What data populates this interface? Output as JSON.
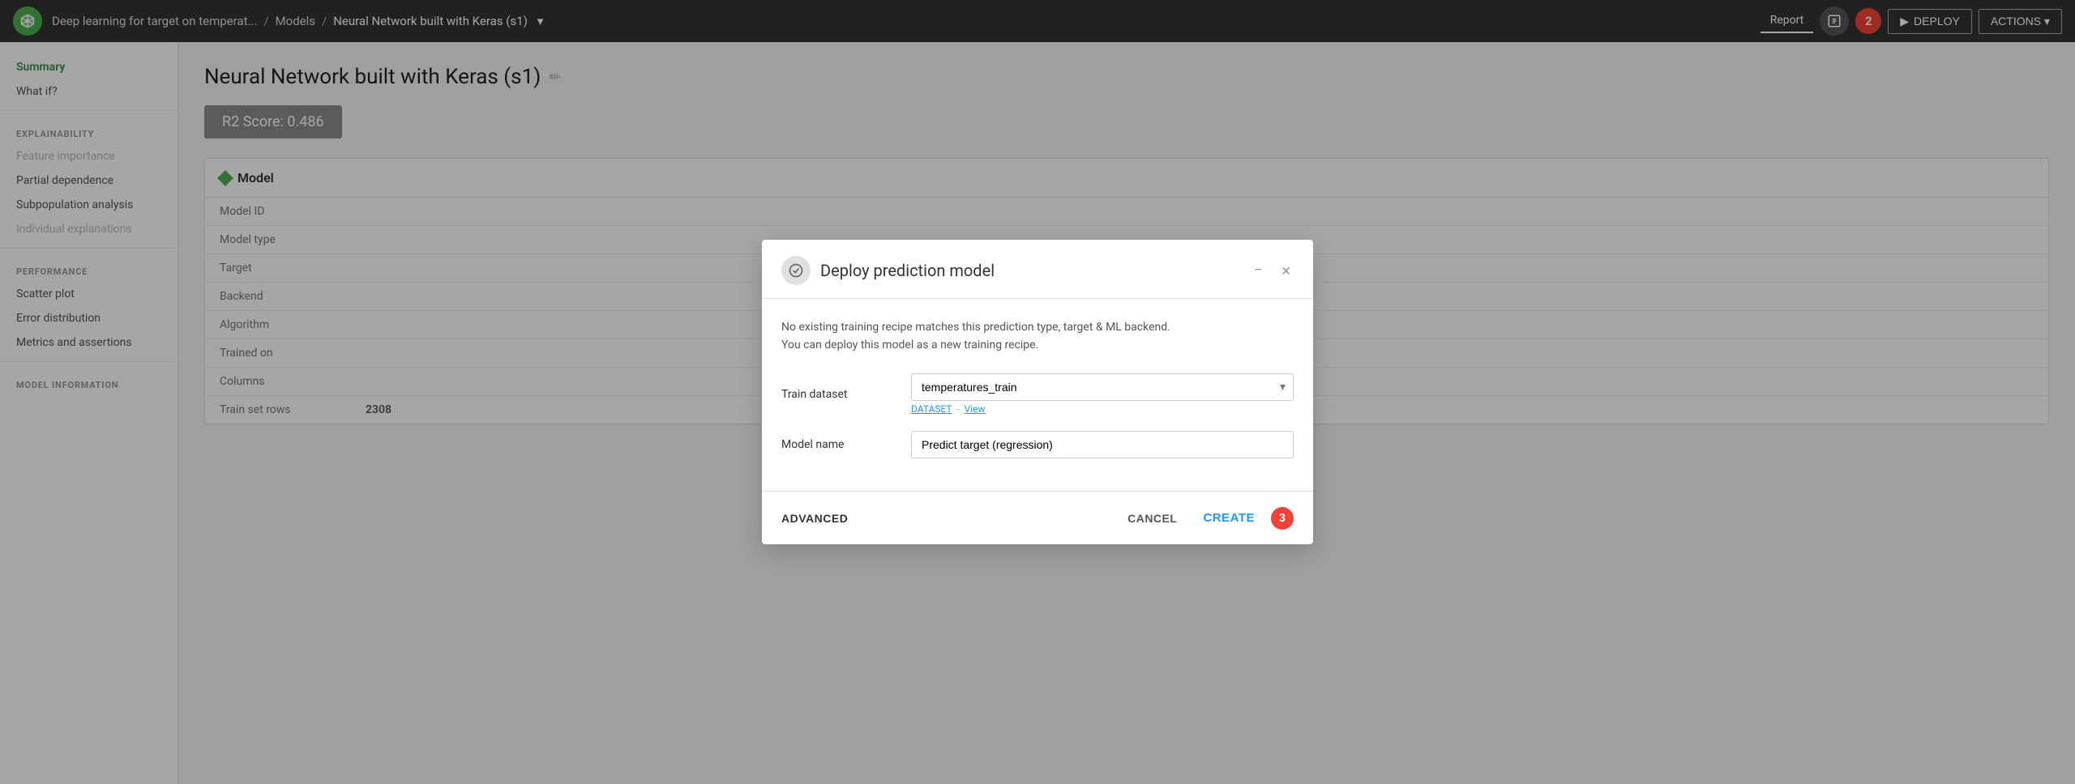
{
  "app": {
    "logo_alt": "Dataiku logo"
  },
  "topnav": {
    "breadcrumb": [
      {
        "label": "Deep learning for target on temperat...",
        "active": false
      },
      {
        "label": "Models",
        "active": false
      },
      {
        "label": "Neural Network built with Keras (s1)",
        "active": true
      }
    ],
    "report_label": "Report",
    "deploy_label": "DEPLOY",
    "actions_label": "ACTIONS",
    "step2_badge": "2"
  },
  "sidebar": {
    "summary_label": "Summary",
    "whatif_label": "What if?",
    "explainability_title": "EXPLAINABILITY",
    "feature_importance_label": "Feature importance",
    "partial_dependence_label": "Partial dependence",
    "subpopulation_analysis_label": "Subpopulation analysis",
    "individual_explanations_label": "Individual explanations",
    "performance_title": "PERFORMANCE",
    "scatter_plot_label": "Scatter plot",
    "error_distribution_label": "Error distribution",
    "metrics_assertions_label": "Metrics and assertions",
    "model_information_title": "MODEL INFORMATION"
  },
  "main": {
    "page_title": "Neural Network built with Keras (s1)",
    "edit_icon": "✏",
    "r2_score_label": "R2 Score: 0.486",
    "model_section_title": "Model",
    "table_rows": [
      {
        "label": "Model ID",
        "value": ""
      },
      {
        "label": "Model type",
        "value": ""
      },
      {
        "label": "Target",
        "value": ""
      },
      {
        "label": "Backend",
        "value": ""
      },
      {
        "label": "Algorithm",
        "value": ""
      },
      {
        "label": "Trained on",
        "value": ""
      },
      {
        "label": "Columns",
        "value": ""
      },
      {
        "label": "Train set rows",
        "value": "2308"
      }
    ]
  },
  "modal": {
    "title": "Deploy prediction model",
    "description_line1": "No existing training recipe matches this prediction type, target & ML backend.",
    "description_line2": "You can deploy this model as a new training recipe.",
    "train_dataset_label": "Train dataset",
    "train_dataset_value": "temperatures_train",
    "train_dataset_sub": "DATASET",
    "train_dataset_view": "View",
    "model_name_label": "Model name",
    "model_name_value": "Predict target (regression)",
    "advanced_label": "ADVANCED",
    "cancel_label": "CANCEL",
    "create_label": "CREATE",
    "step3_badge": "3",
    "minimize_icon": "−",
    "close_icon": "×"
  }
}
